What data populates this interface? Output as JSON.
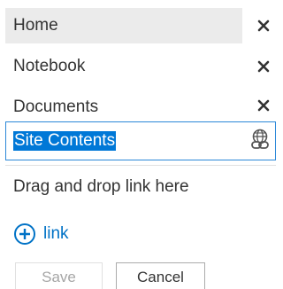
{
  "nav_items": [
    {
      "label": "Home",
      "selected": true,
      "remove_icon": "close-icon"
    },
    {
      "label": "Notebook",
      "selected": false,
      "remove_icon": "close-icon"
    },
    {
      "label": "Documents",
      "selected": false,
      "remove_icon": "close-icon"
    }
  ],
  "edit_item": {
    "value": "Site Contents",
    "icon": "link-globe-icon"
  },
  "drop_zone": {
    "text": "Drag and drop link here"
  },
  "add_link": {
    "label": "link",
    "icon": "plus-circle-icon"
  },
  "actions": {
    "save_label": "Save",
    "save_enabled": false,
    "cancel_label": "Cancel"
  },
  "colors": {
    "accent": "#0078d7",
    "link": "#0072c6",
    "selected_row": "#ebebeb",
    "text": "#333333"
  }
}
